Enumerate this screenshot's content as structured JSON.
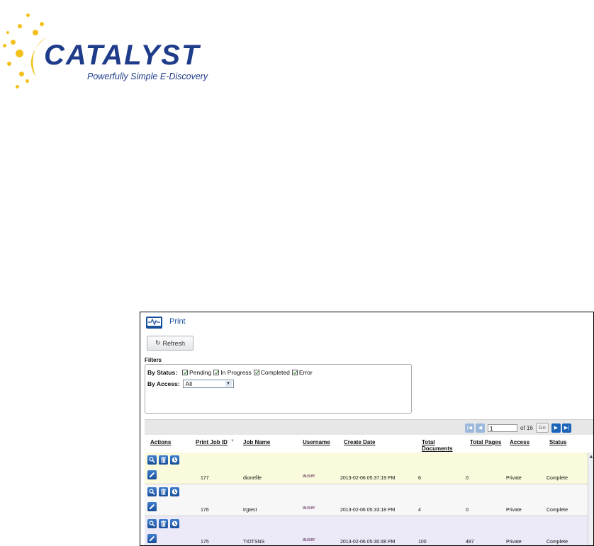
{
  "logo": {
    "title": "CATALYST",
    "tagline": "Powerfully Simple E-Discovery",
    "accent_color": "#f4c11c",
    "brand_color": "#1f3c8a"
  },
  "panel": {
    "title": "Print",
    "refresh_label": "Refresh",
    "filters": {
      "label": "Filters",
      "status_label": "By Status:",
      "status_options": [
        {
          "label": "Pending",
          "checked": true
        },
        {
          "label": "In Progress",
          "checked": true
        },
        {
          "label": "Completed",
          "checked": true
        },
        {
          "label": "Error",
          "checked": true
        }
      ],
      "access_label": "By Access:",
      "access_value": "All"
    },
    "pager": {
      "page": "1",
      "of_label": "of 16",
      "go_label": "Go"
    },
    "columns": [
      "Actions",
      "Print Job ID",
      "Job Name",
      "Username",
      "Create Date",
      "Total Documents",
      "Total Pages",
      "Access",
      "Status"
    ],
    "rows": [
      {
        "id": "177",
        "name": "dionefile",
        "username": "auser",
        "date": "2013-02-06 05:37:19 PM",
        "docs": "6",
        "pages": "0",
        "access": "Private",
        "status": "Complete",
        "bg": "#fafadc"
      },
      {
        "id": "176",
        "name": "trgtest",
        "username": "auser",
        "date": "2013-02-06 05:33:18 PM",
        "docs": "4",
        "pages": "0",
        "access": "Private",
        "status": "Complete",
        "bg": "#f7f7f7"
      },
      {
        "id": "175",
        "name": "TIOTSNS",
        "username": "auser",
        "date": "2013-02-06 05:30:48 PM",
        "docs": "100",
        "pages": "487",
        "access": "Private",
        "status": "Complete",
        "bg": "#eceaf9"
      }
    ]
  }
}
